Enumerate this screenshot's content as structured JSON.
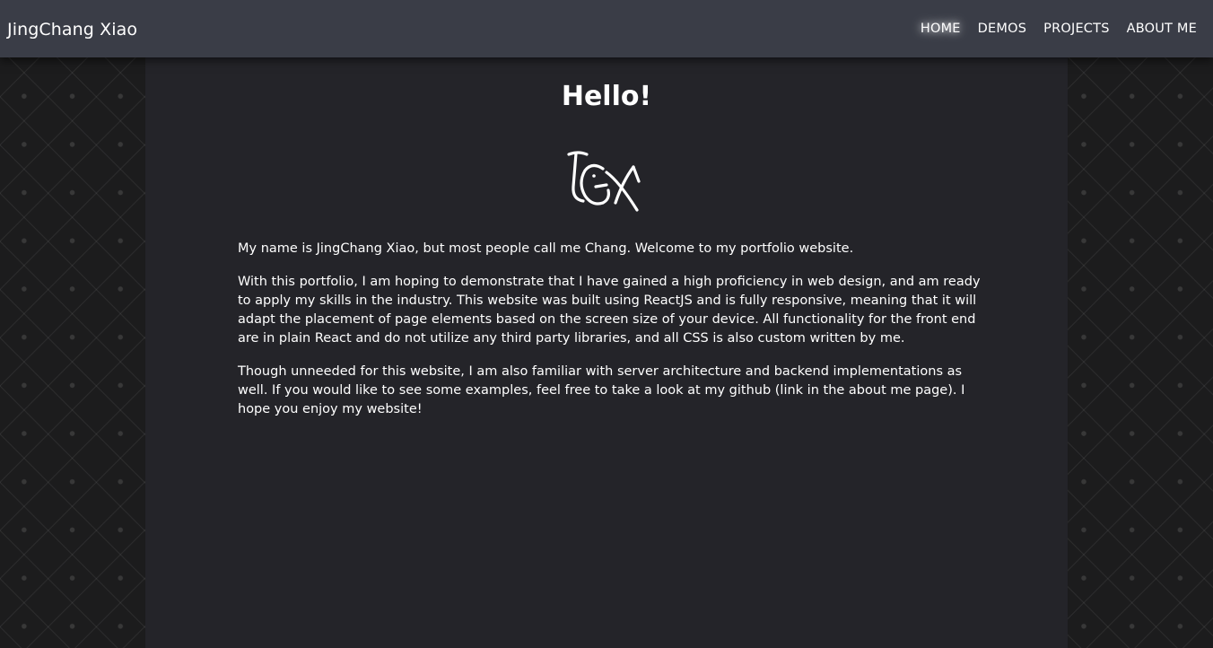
{
  "header": {
    "brand": "JingChang Xiao",
    "nav": [
      {
        "label": "HOME",
        "active": true
      },
      {
        "label": "DEMOS",
        "active": false
      },
      {
        "label": "PROJECTS",
        "active": false
      },
      {
        "label": "ABOUT ME",
        "active": false
      }
    ]
  },
  "main": {
    "title": "Hello!",
    "logo_icon": "jcx-monogram-logo",
    "paragraphs": [
      "My name is JingChang Xiao, but most people call me Chang. Welcome to my portfolio website.",
      "With this portfolio, I am hoping to demonstrate that I have gained a high proficiency in web design, and am ready to apply my skills in the industry. This website was built using ReactJS and is fully responsive, meaning that it will adapt the placement of page elements based on the screen size of your device. All functionality for the front end are in plain React and do not utilize any third party libraries, and all CSS is also custom written by me.",
      "Though unneeded for this website, I am also familiar with server architecture and backend implementations as well. If you would like to see some examples, feel free to take a look at my github (link in the about me page). I hope you enjoy my website!"
    ]
  },
  "colors": {
    "navbar": "#3a3d47",
    "content_panel": "#242429",
    "background": "#1c1c1d",
    "text": "#ffffff"
  }
}
